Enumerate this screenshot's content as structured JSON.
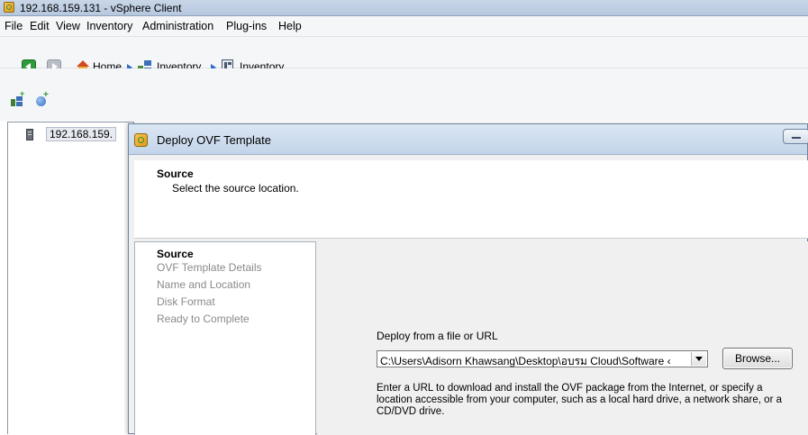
{
  "window": {
    "title": "192.168.159.131 - vSphere Client"
  },
  "menu": [
    "File",
    "Edit",
    "View",
    "Inventory",
    "Administration",
    "Plug-ins",
    "Help"
  ],
  "breadcrumb": [
    "Home",
    "Inventory",
    "Inventory"
  ],
  "inventory_tree": {
    "host_label": "192.168.159."
  },
  "dialog": {
    "title": "Deploy OVF Template",
    "header_title": "Source",
    "header_subtitle": "Select the source location.",
    "steps": [
      {
        "label": "Source",
        "current": true
      },
      {
        "label": "OVF Template Details",
        "current": false
      },
      {
        "label": "Name and Location",
        "current": false
      },
      {
        "label": "Disk Format",
        "current": false
      },
      {
        "label": "Ready to Complete",
        "current": false
      }
    ],
    "deploy_label": "Deploy from a file or URL",
    "source_value": "C:\\Users\\Adisorn Khawsang\\Desktop\\อบรม Cloud\\Software ‹",
    "browse_label": "Browse...",
    "help_text": "Enter a URL to download and install the OVF package from the Internet, or specify a location accessible from your computer, such as a local hard drive, a network share, or a CD/DVD drive."
  },
  "colors": {
    "accent": "#2f6fc8",
    "nav_green": "#2f9a3a",
    "dialog_bg": "#f0f0f0"
  }
}
